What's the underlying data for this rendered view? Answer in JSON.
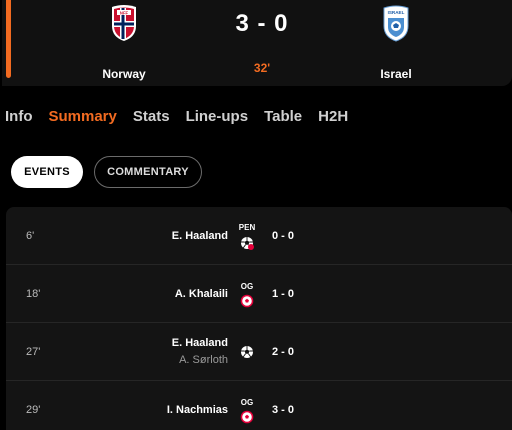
{
  "match": {
    "home_team": "Norway",
    "away_team": "Israel",
    "score": "3 - 0",
    "minute": "32'",
    "home_crest_text": "NFF",
    "away_crest_text": "ISRAEL",
    "accent_color": "#f26b21"
  },
  "tabs": [
    {
      "label": "Info"
    },
    {
      "label": "Summary",
      "active": true
    },
    {
      "label": "Stats"
    },
    {
      "label": "Line-ups"
    },
    {
      "label": "Table"
    },
    {
      "label": "H2H"
    }
  ],
  "filters": {
    "events_label": "EVENTS",
    "commentary_label": "COMMENTARY"
  },
  "events": [
    {
      "minute": "6'",
      "player": "E. Haaland",
      "assist": "",
      "tag": "PEN",
      "icon": "penalty-goal-icon",
      "score": "0 - 0"
    },
    {
      "minute": "18'",
      "player": "A. Khalaili",
      "assist": "",
      "tag": "OG",
      "icon": "own-goal-icon",
      "score": "1 - 0"
    },
    {
      "minute": "27'",
      "player": "E. Haaland",
      "assist": "A. Sørloth",
      "tag": "",
      "icon": "goal-icon",
      "score": "2 - 0"
    },
    {
      "minute": "29'",
      "player": "I. Nachmias",
      "assist": "",
      "tag": "OG",
      "icon": "own-goal-icon",
      "score": "3 - 0"
    }
  ]
}
